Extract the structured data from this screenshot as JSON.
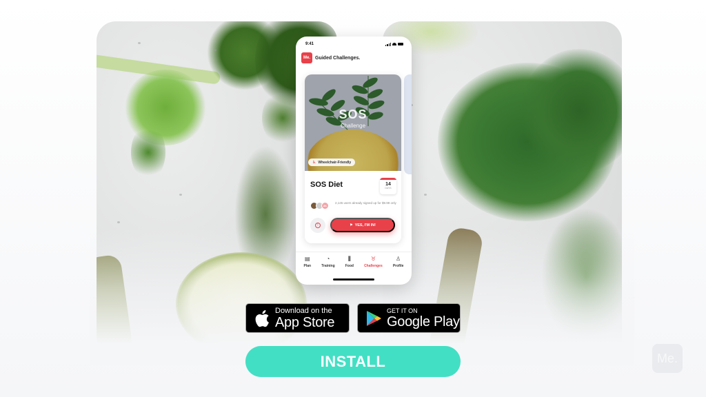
{
  "phone": {
    "status_time": "9:41",
    "app_logo_text": "Me.",
    "app_title": "Guided Challenges.",
    "card": {
      "hero_title": "SOS",
      "hero_subtitle": "Challenge",
      "badge": "Wheelchair-Friendly",
      "title": "SOS Diet",
      "duration_number": "14",
      "duration_unit": "DAYS",
      "avatar_count": "2K",
      "signup_text": "2,145 users already signed up for $9.99 only",
      "cta_label": "YES, I'M IN!"
    },
    "tabs": [
      {
        "label": "Plan",
        "icon": "plan-icon",
        "active": false
      },
      {
        "label": "Training",
        "icon": "training-icon",
        "active": false
      },
      {
        "label": "Food",
        "icon": "food-icon",
        "active": false
      },
      {
        "label": "Challenges",
        "icon": "challenges-icon",
        "active": true
      },
      {
        "label": "Profile",
        "icon": "profile-icon",
        "active": false
      }
    ]
  },
  "stores": {
    "apple": {
      "small": "Download on the",
      "big": "App Store"
    },
    "google": {
      "small": "GET IT ON",
      "big": "Google Play"
    }
  },
  "install_label": "INSTALL",
  "watermark": "Me.",
  "colors": {
    "brand_red": "#e8414a",
    "install_teal": "#43dfc4"
  }
}
